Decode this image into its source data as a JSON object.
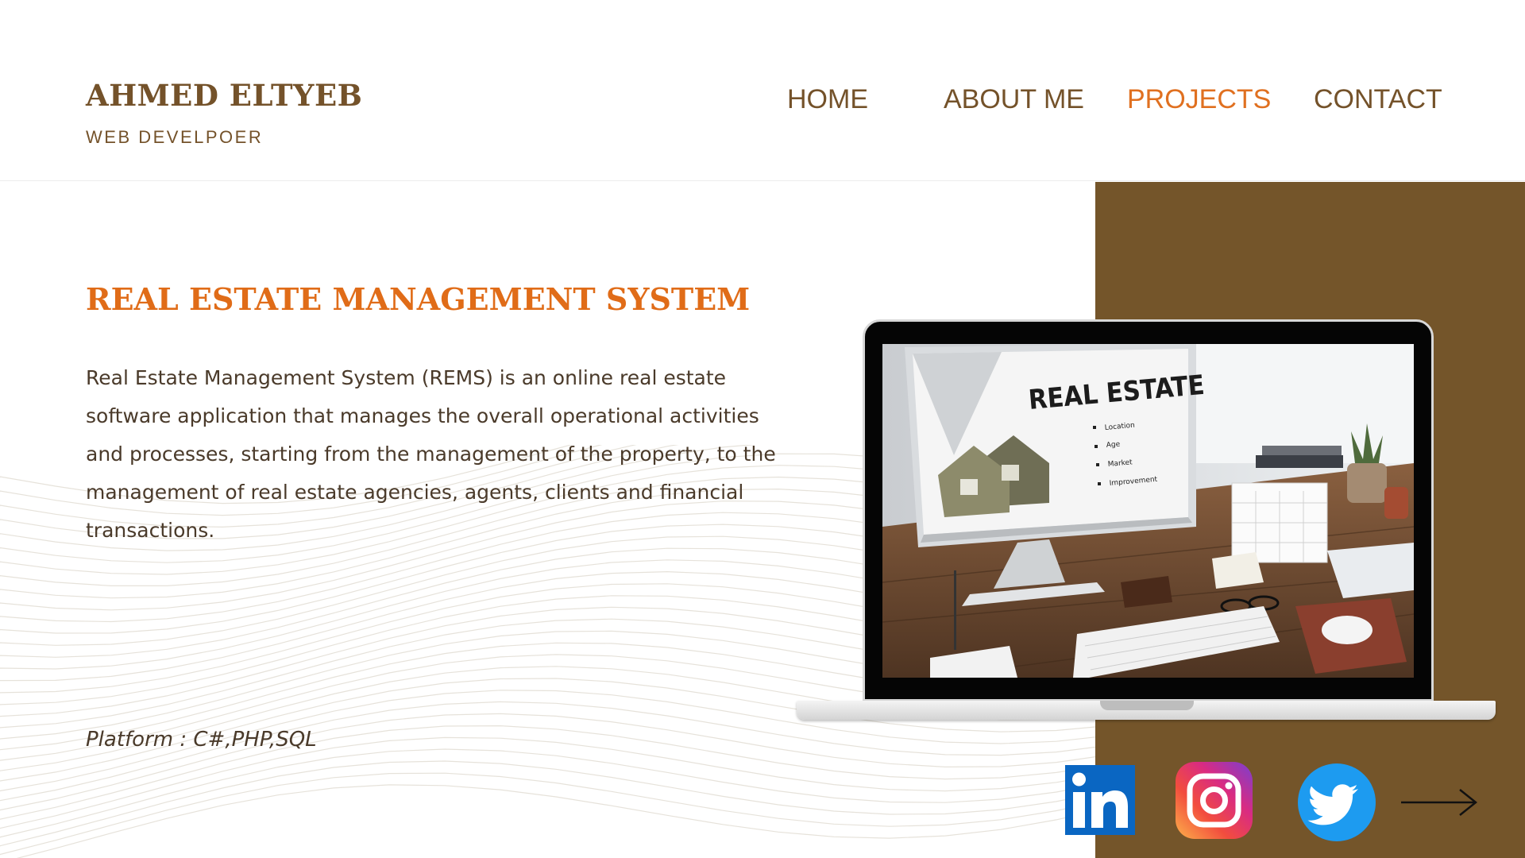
{
  "header": {
    "name": "AHMED ELTYEB",
    "role": "WEB DEVELPOER",
    "nav": [
      {
        "label": "HOME",
        "active": false
      },
      {
        "label": "ABOUT ME",
        "active": false
      },
      {
        "label": "PROJECTS",
        "active": true
      },
      {
        "label": "CONTACT",
        "active": false
      }
    ]
  },
  "project": {
    "title": "REAL ESTATE MANAGEMENT SYSTEM",
    "description": "Real Estate Management System (REMS) is an online real estate software application that manages the overall operational activities and processes, starting from the management of the property, to the management of real estate agencies, agents, clients and financial transactions.",
    "platform": "Platform : C#,PHP,SQL"
  },
  "screen_image": {
    "heading": "REAL ESTATE",
    "bullets": [
      "Location",
      "Age",
      "Market",
      "Improvement"
    ]
  },
  "social": [
    "linkedin-icon",
    "instagram-icon",
    "twitter-icon",
    "arrow-right-icon"
  ],
  "colors": {
    "brown": "#74552a",
    "accent": "#e06c18",
    "text": "#4a3a2a"
  }
}
